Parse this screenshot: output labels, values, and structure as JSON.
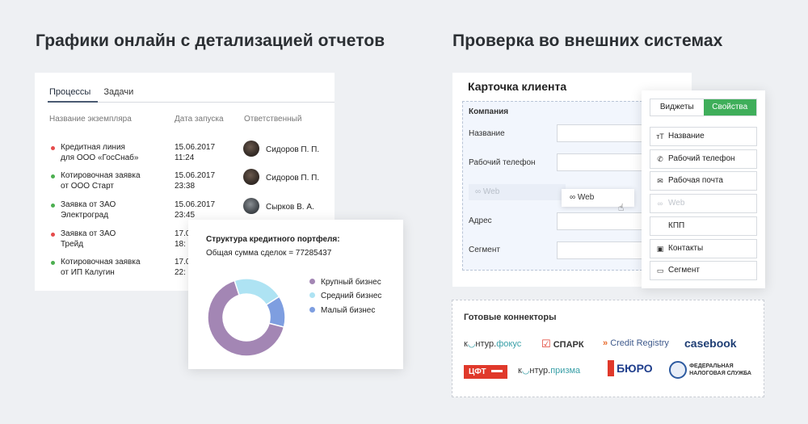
{
  "headings": {
    "left": "Графики онлайн с детализацией отчетов",
    "right": "Проверка во внешних системах"
  },
  "processes": {
    "tabs": [
      "Процессы",
      "Задачи"
    ],
    "columns": [
      "Название экземпляра",
      "Дата запуска",
      "Ответственный"
    ],
    "rows": [
      {
        "name1": "Кредитная линия",
        "name2": "для ООО «ГосСнаб»",
        "date": "15.06.2017",
        "time": "11:24",
        "person": "Сидоров П. П.",
        "status_color": "#e54b4b"
      },
      {
        "name1": "Котировочная заявка",
        "name2": "от ООО Старт",
        "date": "15.06.2017",
        "time": "23:38",
        "person": "Сидоров П. П.",
        "status_color": "#4caf50"
      },
      {
        "name1": "Заявка от ЗАО",
        "name2": "Электроград",
        "date": "15.06.2017",
        "time": "23:45",
        "person": "Сырков В. А.",
        "status_color": "#4caf50"
      },
      {
        "name1": "Заявка от ЗАО",
        "name2": "Трейд",
        "date": "17.0",
        "time": "18:",
        "person": "",
        "status_color": "#e54b4b"
      },
      {
        "name1": "Котировочная заявка",
        "name2": "от ИП Калугин",
        "date": "17.0",
        "time": "22:",
        "person": "",
        "status_color": "#4caf50"
      }
    ]
  },
  "portfolio": {
    "title": "Структура кредитного портфеля:",
    "summary": "Общая сумма сделок  = 77285437"
  },
  "chart_data": {
    "type": "pie",
    "title": "Структура кредитного портфеля:",
    "categories": [
      "Крупный бизнес",
      "Средний бизнес",
      "Малый бизнес"
    ],
    "values": [
      66,
      21,
      13
    ],
    "colors": [
      "#a386b4",
      "#aee3f3",
      "#7e9ee0"
    ],
    "donut": true
  },
  "client_card": {
    "title": "Карточка клиента",
    "group": "Компания",
    "fields": [
      "Название",
      "Рабочий телефон",
      "Адрес",
      "Сегмент"
    ],
    "ghost": "Web",
    "dragging": "Web"
  },
  "widgets": {
    "tabs": [
      "Виджеты",
      "Свойства"
    ],
    "items": [
      {
        "label": "Название",
        "icon": "text-size-icon",
        "glyph": "тТ",
        "disabled": false
      },
      {
        "label": "Рабочий телефон",
        "icon": "phone-icon",
        "glyph": "✆",
        "disabled": false
      },
      {
        "label": "Рабочая почта",
        "icon": "mail-icon",
        "glyph": "✉",
        "disabled": false
      },
      {
        "label": "Web",
        "icon": "link-icon",
        "glyph": "∞",
        "disabled": true
      },
      {
        "label": "КПП",
        "icon": "blank-icon",
        "glyph": "",
        "disabled": false
      },
      {
        "label": "Контакты",
        "icon": "contact-icon",
        "glyph": "▣",
        "disabled": false
      },
      {
        "label": "Сегмент",
        "icon": "folder-icon",
        "glyph": "▭",
        "disabled": false
      }
    ]
  },
  "connectors": {
    "title": "Готовые коннекторы",
    "logos": [
      {
        "a": "к",
        "b": "нтур.",
        "c": "фокус"
      },
      {
        "text": "СПАРК"
      },
      {
        "text": "Credit Registry"
      },
      {
        "text": "casebook"
      },
      {
        "text": "ЦФТ"
      },
      {
        "a": "к",
        "b": "нтур.",
        "c": "призма"
      },
      {
        "text": "БЮРО"
      },
      {
        "text1": "ФЕДЕРАЛЬНАЯ",
        "text2": "НАЛОГОВАЯ СЛУЖБА"
      }
    ]
  }
}
